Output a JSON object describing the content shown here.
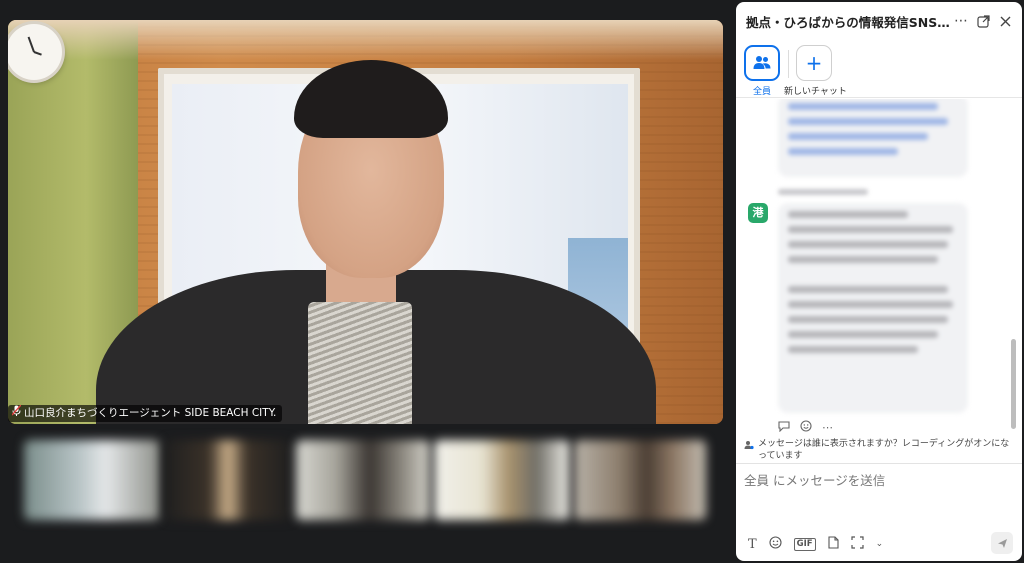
{
  "meeting": {
    "speaker_name": "山口良介まちづくりエージェント SIDE BEACH CITY."
  },
  "chat": {
    "title": "拠点・ひろばからの情報発信SNSとの向き合...",
    "header_icons": [
      "more-icon",
      "popout-icon",
      "close-icon"
    ],
    "recipients": [
      {
        "label": "全員",
        "icon": "people-icon",
        "active": true
      },
      {
        "label": "新しいチャット",
        "icon": "plus-icon",
        "active": false
      }
    ],
    "avatar_initial": "港",
    "notice": "メッセージは誰に表示されますか？レコーディングがオンになっています",
    "compose_placeholder": "全員 にメッセージを送信",
    "toolbar_icons": [
      "text-format-icon",
      "emoji-icon",
      "gif-icon",
      "file-icon",
      "screenshot-icon",
      "chevron-down-icon"
    ],
    "toolbar_gif_label": "GIF"
  },
  "colors": {
    "accent": "#0e71eb",
    "avatar_green": "#29a86a",
    "background": "#1b1c1e"
  }
}
